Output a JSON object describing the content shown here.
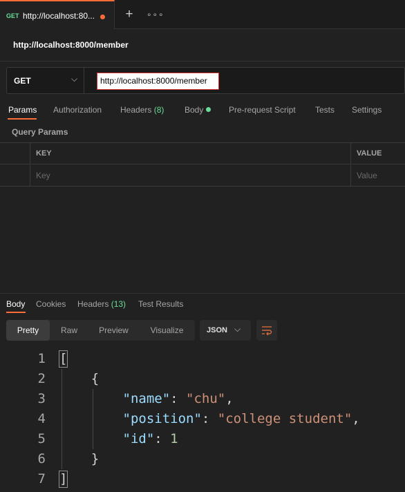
{
  "tab": {
    "method": "GET",
    "title": "http://localhost:80...",
    "add_label": "+",
    "more_label": "∘∘∘"
  },
  "request": {
    "title": "http://localhost:8000/member",
    "method": "GET",
    "url": "http://localhost:8000/member"
  },
  "request_tabs": [
    {
      "label": "Params"
    },
    {
      "label": "Authorization"
    },
    {
      "label": "Headers",
      "count": "(8)"
    },
    {
      "label": "Body"
    },
    {
      "label": "Pre-request Script"
    },
    {
      "label": "Tests"
    },
    {
      "label": "Settings"
    }
  ],
  "query_params": {
    "title": "Query Params",
    "headers": {
      "key": "KEY",
      "value": "VALUE"
    },
    "placeholders": {
      "key": "Key",
      "value": "Value"
    }
  },
  "response_tabs": [
    {
      "label": "Body"
    },
    {
      "label": "Cookies"
    },
    {
      "label": "Headers",
      "count": "(13)"
    },
    {
      "label": "Test Results"
    }
  ],
  "format_buttons": [
    {
      "label": "Pretty"
    },
    {
      "label": "Raw"
    },
    {
      "label": "Preview"
    },
    {
      "label": "Visualize"
    }
  ],
  "language": "JSON",
  "code": {
    "line_numbers": [
      "1",
      "2",
      "3",
      "4",
      "5",
      "6",
      "7"
    ],
    "keys": [
      "\"name\"",
      "\"position\"",
      "\"id\""
    ],
    "values": [
      "\"chu\"",
      "\"college student\"",
      "1"
    ]
  },
  "colors": {
    "accent": "#ff6c37",
    "success": "#6bdd9a",
    "json_key": "#9cdcfe",
    "json_string": "#ce9178",
    "json_number": "#b5cea8"
  }
}
